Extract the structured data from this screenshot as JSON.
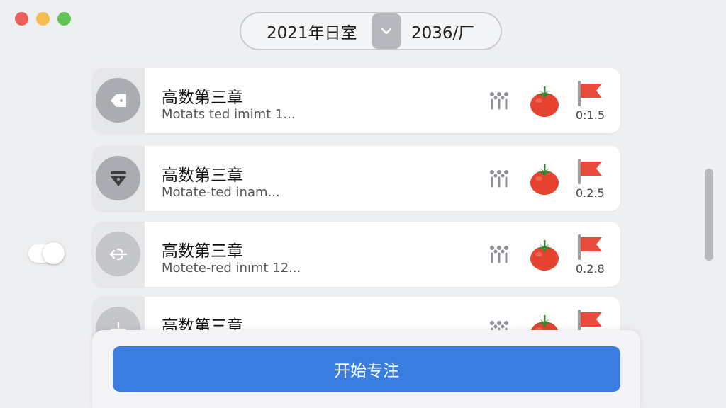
{
  "window": {
    "controls": [
      "close",
      "minimize",
      "zoom"
    ]
  },
  "selector": {
    "left_label": "2021年日室",
    "right_label": "2036/厂"
  },
  "tasks": [
    {
      "title": "高数第三章",
      "subtitle": "Motats ted imimt 1...",
      "value": "0:1.5",
      "icon": "tag-icon"
    },
    {
      "title": "高数第三章",
      "subtitle": "Motate-ted inam...",
      "value": "0.2.5",
      "icon": "pen-nib-icon"
    },
    {
      "title": "高数第三章",
      "subtitle": "Motete-red inımt 12...",
      "value": "0.2.8",
      "icon": "swap-arrow-icon"
    },
    {
      "title": "高数第三章",
      "subtitle": "",
      "value": "",
      "icon": "plus-minus-icon"
    }
  ],
  "footer": {
    "start_label": "开始专注"
  },
  "colors": {
    "accent": "#3a7de1",
    "tomato": "#e5432f",
    "flag": "#e94b3c",
    "background": "#eeeff1"
  }
}
